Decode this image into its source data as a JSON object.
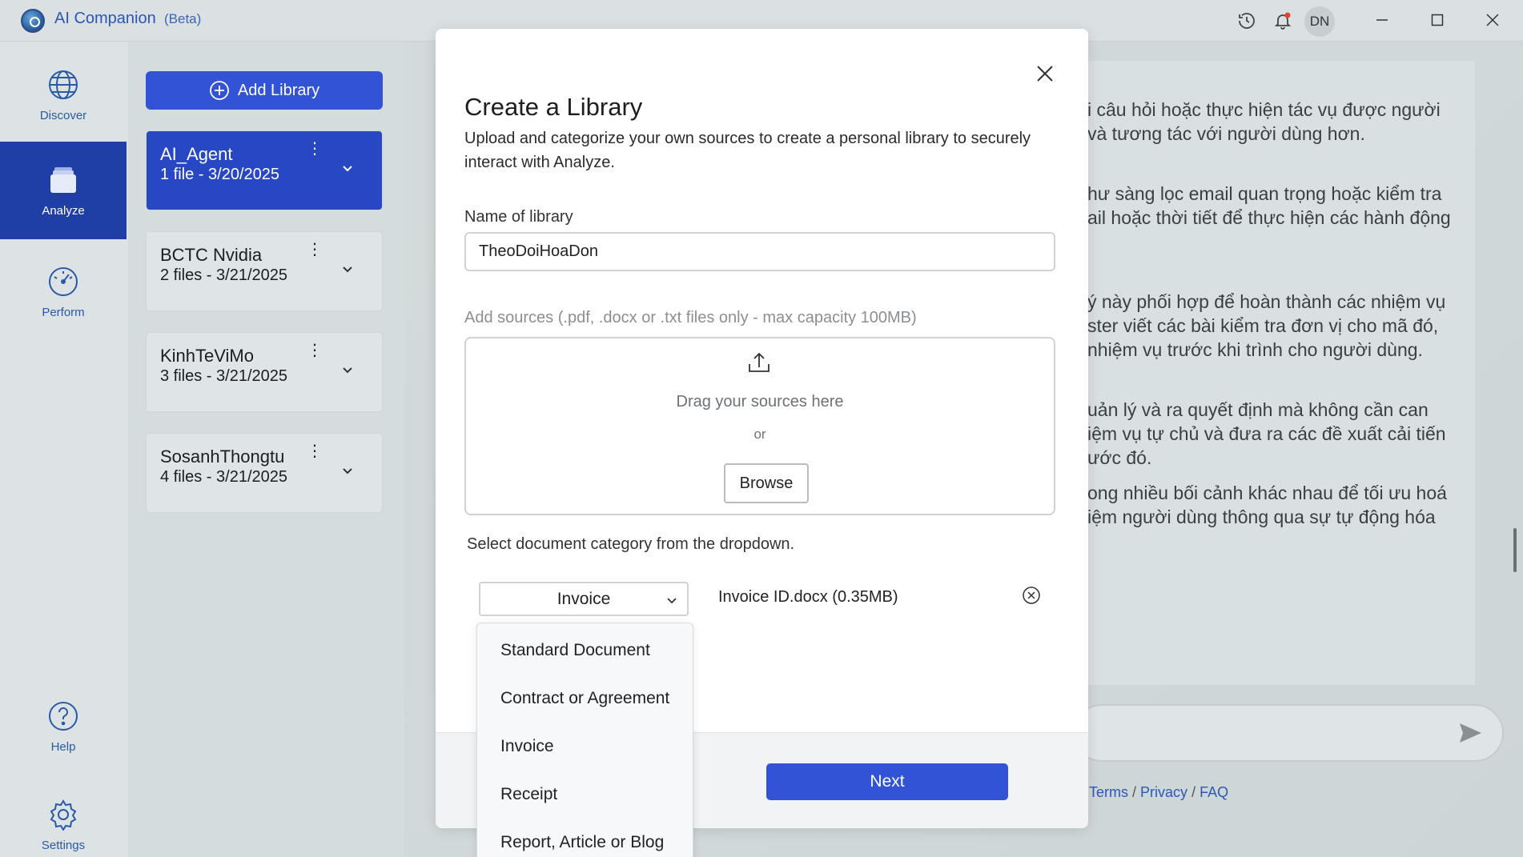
{
  "app": {
    "name": "AI Companion",
    "beta_label": "(Beta)",
    "user_initials": "DN",
    "logo_badge": "BETA"
  },
  "nav": {
    "items": [
      {
        "label": "Discover",
        "icon": "globe-icon",
        "active": false
      },
      {
        "label": "Analyze",
        "icon": "files-icon",
        "active": true
      },
      {
        "label": "Perform",
        "icon": "gauge-icon",
        "active": false
      },
      {
        "label": "Help",
        "icon": "help-icon",
        "active": false
      },
      {
        "label": "Settings",
        "icon": "gear-icon",
        "active": false
      }
    ]
  },
  "libraries": {
    "add_label": "Add Library",
    "items": [
      {
        "name": "AI_Agent",
        "meta": "1 file - 3/20/2025",
        "selected": true
      },
      {
        "name": "BCTC Nvidia",
        "meta": "2 files - 3/21/2025",
        "selected": false
      },
      {
        "name": "KinhTeViMo",
        "meta": "3 files - 3/21/2025",
        "selected": false
      },
      {
        "name": "SosanhThongtu",
        "meta": "4 files - 3/21/2025",
        "selected": false
      }
    ]
  },
  "chat": {
    "lines": [
      "i câu hỏi hoặc thực hiện tác vụ được người",
      "và tương tác với người dùng hơn.",
      "hư sàng lọc email quan trọng hoặc kiểm tra",
      "ail hoặc thời tiết để thực hiện các hành động",
      "ý này phối hợp để hoàn thành các nhiệm vụ",
      "ster viết các bài kiểm tra đơn vị cho mã đó,",
      "nhiệm vụ trước khi trình cho người dùng.",
      "uản lý và ra quyết định mà không cần can",
      "iệm vụ tự chủ và đưa ra các đề xuất cải tiến",
      "ước đó.",
      "ong nhiều bối cảnh khác nhau để tối ưu hoá",
      "iệm người dùng thông qua sự tự động hóa"
    ],
    "footer": {
      "terms": "Terms",
      "privacy": "Privacy",
      "faq": "FAQ",
      "sep": "/"
    }
  },
  "modal": {
    "title": "Create a Library",
    "subtitle": "Upload and categorize your own sources to create a personal library to securely interact with Analyze.",
    "name_label": "Name of library",
    "name_value": "TheoDoiHoaDon",
    "sources_label": "Add sources (.pdf, .docx or .txt files only - max capacity 100MB)",
    "drag_text": "Drag your sources here",
    "or_text": "or",
    "browse_label": "Browse",
    "category_label": "Select document category from the dropdown.",
    "selected_category": "Invoice",
    "file_name": "Invoice ID.docx (0.35MB)",
    "next_label": "Next",
    "category_options": [
      "Standard Document",
      "Contract or Agreement",
      "Invoice",
      "Receipt",
      "Report, Article or Blog"
    ]
  },
  "colors": {
    "accent": "#3353d6",
    "nav_active": "#1f3fa6",
    "link": "#2c57b8"
  }
}
